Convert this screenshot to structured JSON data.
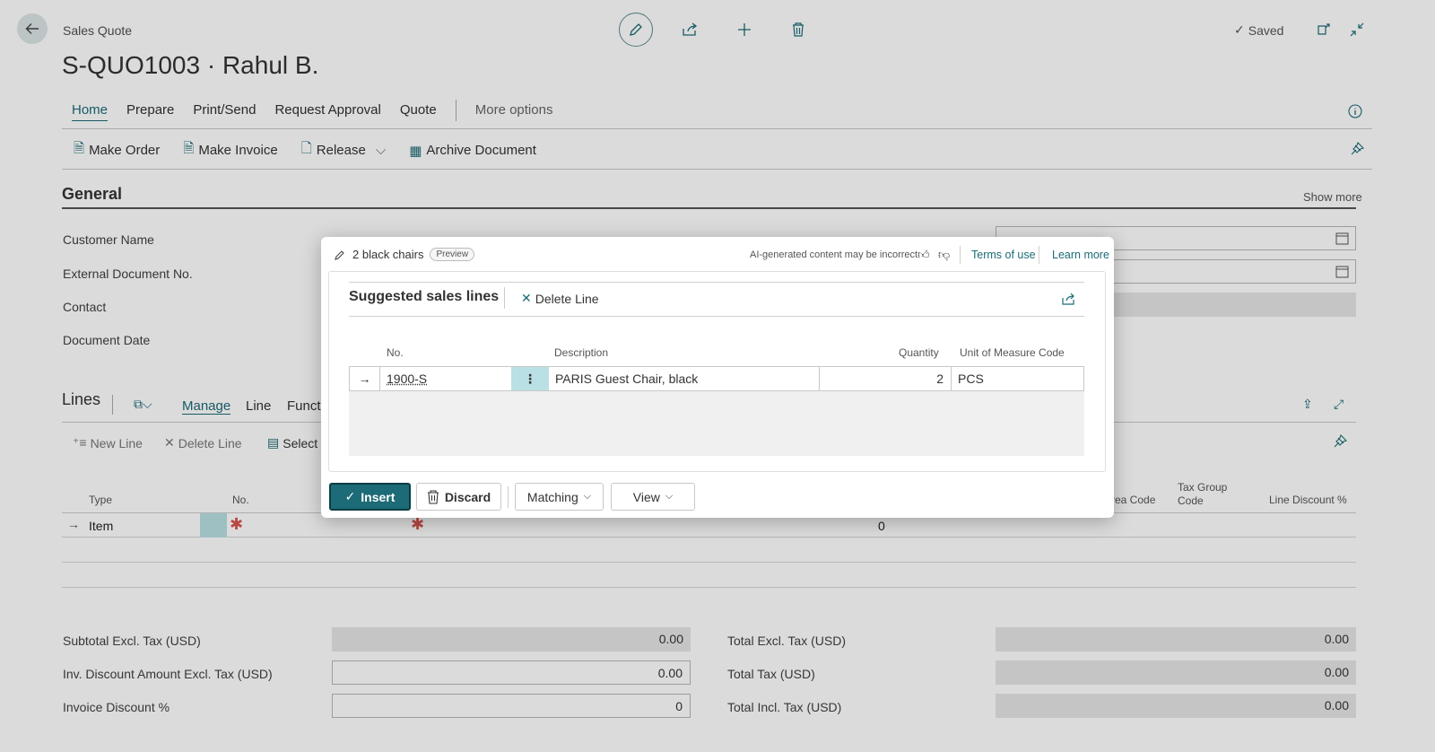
{
  "header": {
    "breadcrumb": "Sales Quote",
    "title": "S-QUO1003 · Rahul B.",
    "saved_label": "Saved"
  },
  "menu": {
    "items": [
      "Home",
      "Prepare",
      "Print/Send",
      "Request Approval",
      "Quote"
    ],
    "more": "More options"
  },
  "actions": {
    "make_order": "Make Order",
    "make_invoice": "Make Invoice",
    "release": "Release",
    "archive": "Archive Document"
  },
  "general": {
    "title": "General",
    "show_more": "Show more",
    "labels": [
      "Customer Name",
      "External Document No.",
      "Contact",
      "Document Date"
    ]
  },
  "lines": {
    "title": "Lines",
    "tabs": [
      "Manage",
      "Line",
      "Functi"
    ],
    "toolbar": [
      "New Line",
      "Delete Line",
      "Select"
    ],
    "columns": {
      "type": "Type",
      "no": "No.",
      "area_code": "rea Code",
      "tax_group_code": "Tax Group Code",
      "line_discount": "Line Discount %"
    },
    "row": {
      "type": "Item",
      "quantity": "0"
    }
  },
  "totals": {
    "left": [
      {
        "label": "Subtotal Excl. Tax (USD)",
        "value": "0.00"
      },
      {
        "label": "Inv. Discount Amount Excl. Tax (USD)",
        "value": "0.00"
      },
      {
        "label": "Invoice Discount %",
        "value": "0"
      }
    ],
    "right": [
      {
        "label": "Total Excl. Tax (USD)",
        "value": "0.00"
      },
      {
        "label": "Total Tax (USD)",
        "value": "0.00"
      },
      {
        "label": "Total Incl. Tax (USD)",
        "value": "0.00"
      }
    ]
  },
  "dialog": {
    "prompt": "2 black chairs",
    "badge": "Preview",
    "ai_note": "AI-generated content may be incorrect",
    "terms": "Terms of use",
    "learn_more": "Learn more",
    "section_title": "Suggested sales lines",
    "delete_line": "Delete Line",
    "columns": {
      "no": "No.",
      "description": "Description",
      "quantity": "Quantity",
      "uom": "Unit of Measure Code"
    },
    "row": {
      "no": "1900-S",
      "description": "PARIS Guest Chair, black",
      "quantity": "2",
      "uom": "PCS"
    },
    "buttons": {
      "insert": "Insert",
      "discard": "Discard",
      "matching": "Matching",
      "view": "View"
    }
  },
  "colors": {
    "accent": "#1c6b76",
    "required": "#d9534f",
    "selection": "#b9e0e4"
  }
}
